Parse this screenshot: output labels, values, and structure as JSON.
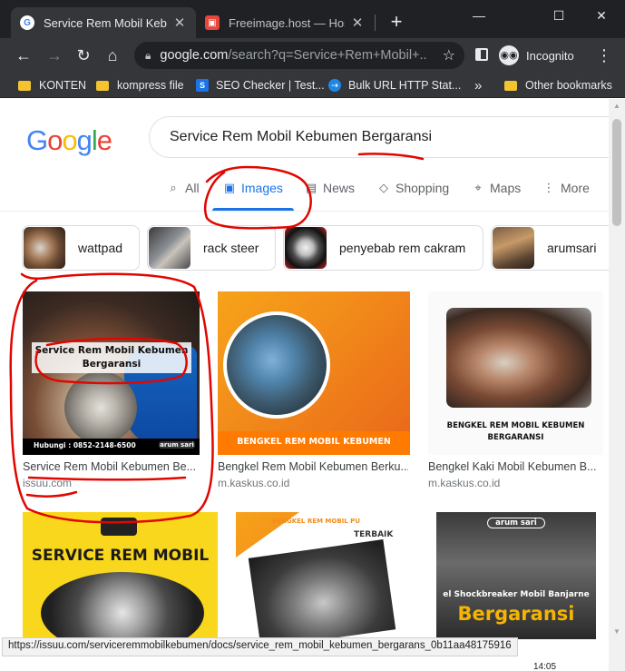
{
  "browser": {
    "tabs": [
      {
        "title": "Service Rem Mobil Kebumen",
        "favicon": "google-g-icon"
      },
      {
        "title": "Freeimage.host — Hosting",
        "favicon": "freeimage-icon"
      }
    ],
    "new_tab": "+",
    "window_controls": {
      "minimize": "—",
      "maximize": "☐",
      "close": "✕"
    },
    "address": {
      "domain": "google.com",
      "path": "/search?q=Service+Rem+Mobil+..."
    },
    "incognito_label": "Incognito",
    "bookmarks": [
      {
        "label": "KONTEN",
        "icon": "folder-icon"
      },
      {
        "label": "kompress file",
        "icon": "folder-icon"
      },
      {
        "label": "SEO Checker | Test...",
        "icon": "seo-icon"
      },
      {
        "label": "Bulk URL HTTP Stat...",
        "icon": "bulk-url-icon"
      },
      {
        "label": "Other bookmarks",
        "icon": "folder-icon"
      }
    ],
    "bookmarks_more": "»",
    "status_url": "https://issuu.com/serviceremmobilkebumen/docs/service_rem_mobil_kebumen_bergarans_0b11aa48175916",
    "clock": "14:05"
  },
  "google": {
    "logo": [
      "G",
      "o",
      "o",
      "g",
      "l",
      "e"
    ],
    "logo_colors": [
      "#4285F4",
      "#EA4335",
      "#FBBC05",
      "#4285F4",
      "#34A853",
      "#EA4335"
    ],
    "query": "Service Rem Mobil Kebumen Bergaransi",
    "tabs": [
      {
        "label": "All",
        "icon": "search-icon"
      },
      {
        "label": "Images",
        "icon": "image-icon",
        "active": true
      },
      {
        "label": "News",
        "icon": "news-icon"
      },
      {
        "label": "Shopping",
        "icon": "tag-icon"
      },
      {
        "label": "Maps",
        "icon": "map-pin-icon"
      },
      {
        "label": "More",
        "icon": "more-vert-icon"
      }
    ],
    "chips": [
      {
        "label": "wattpad"
      },
      {
        "label": "rack steer"
      },
      {
        "label": "penyebab rem cakram"
      },
      {
        "label": "arumsari"
      }
    ],
    "results": [
      {
        "caption": "Service Rem Mobil Kebumen Be...",
        "source": "issuu.com",
        "img_title": "Service Rem Mobil Kebumen Bergaransi",
        "img_footer": "Hubungi : 0852-2148-6500",
        "img_brand": "arum sari"
      },
      {
        "caption": "Bengkel Rem Mobil Kebumen Berku...",
        "source": "m.kaskus.co.id",
        "img_title": "BENGKEL REM MOBIL KEBUMEN"
      },
      {
        "caption": "Bengkel Kaki Mobil Kebumen B...",
        "source": "m.kaskus.co.id",
        "img_title": "BENGKEL REM MOBIL KEBUMEN BERGARANSI"
      },
      {
        "caption": "",
        "source": "",
        "img_title": "SERVICE REM MOBIL"
      },
      {
        "caption": "",
        "source": "",
        "img_title": "BENGKEL REM MOBIL PU",
        "img_sub": "TERBAIK"
      },
      {
        "caption": "",
        "source": "",
        "img_title": "Bergaransi",
        "img_sub": "el Shockbreaker Mobil Banjarne",
        "img_brand": "arum sari"
      }
    ]
  }
}
